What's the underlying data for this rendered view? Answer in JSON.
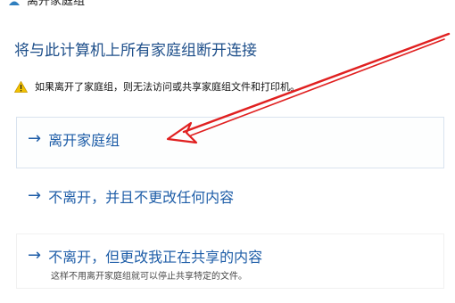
{
  "window": {
    "title": "离开家庭组",
    "title_icon": "homegroup-icon"
  },
  "main": {
    "headline": "将与此计算机上所有家庭组断开连接",
    "warning": {
      "icon": "warning-icon",
      "text": "如果离开了家庭组，则无法访问或共享家庭组文件和打印机。"
    },
    "options": [
      {
        "arrow": "→",
        "label": "离开家庭组"
      },
      {
        "arrow": "→",
        "label": "不离开，并且不更改任何内容"
      },
      {
        "arrow": "→",
        "label": "不离开，但更改我正在共享的内容",
        "description": "这样不用离开家庭组就可以停止共享特定的文件。"
      }
    ]
  },
  "colors": {
    "link": "#1f5ea8",
    "headline": "#1e4f8a",
    "annotation": "#e02020"
  }
}
